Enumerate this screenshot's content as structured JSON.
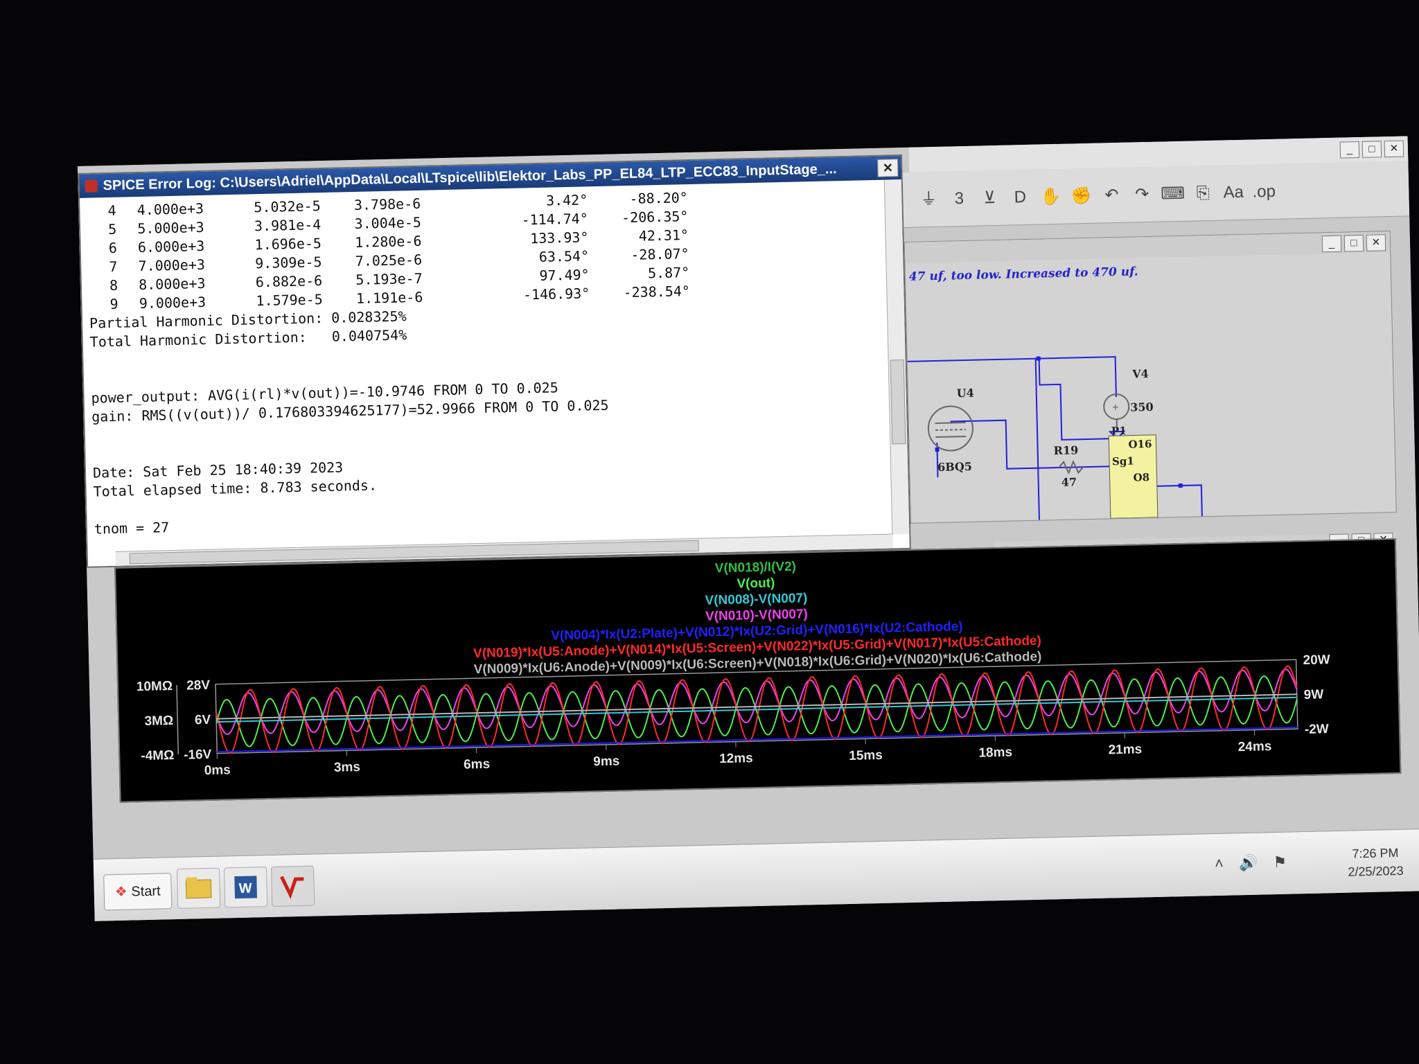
{
  "errlog": {
    "title": "SPICE Error Log: C:\\Users\\Adriel\\AppData\\Local\\LTspice\\lib\\Elektor_Labs_PP_EL84_LTP_ECC83_InputStage_...",
    "close": "✕",
    "harmonics": [
      {
        "n": "4",
        "freq": "4.000e+3",
        "fourier": "5.032e-5",
        "normalized": "3.798e-6",
        "phase": "3.42°",
        "norm_phase": "-88.20°"
      },
      {
        "n": "5",
        "freq": "5.000e+3",
        "fourier": "3.981e-4",
        "normalized": "3.004e-5",
        "phase": "-114.74°",
        "norm_phase": "-206.35°"
      },
      {
        "n": "6",
        "freq": "6.000e+3",
        "fourier": "1.696e-5",
        "normalized": "1.280e-6",
        "phase": "133.93°",
        "norm_phase": "42.31°"
      },
      {
        "n": "7",
        "freq": "7.000e+3",
        "fourier": "9.309e-5",
        "normalized": "7.025e-6",
        "phase": "63.54°",
        "norm_phase": "-28.07°"
      },
      {
        "n": "8",
        "freq": "8.000e+3",
        "fourier": "6.882e-6",
        "normalized": "5.193e-7",
        "phase": "97.49°",
        "norm_phase": "5.87°"
      },
      {
        "n": "9",
        "freq": "9.000e+3",
        "fourier": "1.579e-5",
        "normalized": "1.191e-6",
        "phase": "-146.93°",
        "norm_phase": "-238.54°"
      }
    ],
    "phd": "Partial Harmonic Distortion: 0.028325%",
    "thd": "Total Harmonic Distortion:   0.040754%",
    "power_output": "power_output: AVG(i(rl)*v(out))=-10.9746 FROM 0 TO 0.025",
    "gain": "gain: RMS((v(out))/ 0.176803394625177)=52.9966 FROM 0 TO 0.025",
    "date": "Date: Sat Feb 25 18:40:39 2023",
    "elapsed": "Total elapsed time: 8.783 seconds.",
    "tnom": "tnom = 27"
  },
  "schematic": {
    "comment": "47 uf, too low. Increased to 470 uf.",
    "labels": {
      "u4": "U4",
      "tube": "6BQ5",
      "v4": "V4",
      "v4val": "350",
      "r19": "R19",
      "r19val": "47",
      "p1": "P1",
      "o16": "O16",
      "sg1": "Sg1",
      "o8": "O8"
    }
  },
  "toolbar_icons": [
    "ground-icon",
    "inductor-icon",
    "diode-icon",
    "component-icon",
    "hand-drag-icon",
    "hand-move-icon",
    "undo-icon",
    "redo-icon",
    "text-icon",
    "spice-directive-icon",
    "font-icon",
    "op-icon"
  ],
  "toolbar_glyphs": [
    "⏚",
    "3",
    "⊻",
    "D",
    "✋",
    "✊",
    "↶",
    "↷",
    "⌨",
    "⎘",
    "Aa",
    ".op"
  ],
  "window_buttons": [
    "_",
    "□",
    "✕"
  ],
  "waveform": {
    "traces": [
      {
        "label": "V(N018)/I(V2)",
        "color": "#2fbf40"
      },
      {
        "label": "V(out)",
        "color": "#4df04d"
      },
      {
        "label": "V(N008)-V(N007)",
        "color": "#34c8d8"
      },
      {
        "label": "V(N010)-V(N007)",
        "color": "#f040f0"
      },
      {
        "label": "V(N004)*Ix(U2:Plate)+V(N012)*Ix(U2:Grid)+V(N016)*Ix(U2:Cathode)",
        "color": "#2020ff"
      },
      {
        "label": "V(N019)*Ix(U5:Anode)+V(N014)*Ix(U5:Screen)+V(N022)*Ix(U5:Grid)+V(N017)*Ix(U5:Cathode)",
        "color": "#ff2a2a"
      },
      {
        "label": "V(N009)*Ix(U6:Anode)+V(N009)*Ix(U6:Screen)+V(N018)*Ix(U6:Grid)+V(N020)*Ix(U6:Cathode)",
        "color": "#b8b8b8"
      }
    ]
  },
  "chart_data": {
    "type": "line",
    "x_unit": "ms",
    "xlim": [
      0,
      25
    ],
    "x_ticks": [
      "0ms",
      "3ms",
      "6ms",
      "9ms",
      "12ms",
      "15ms",
      "18ms",
      "21ms",
      "24ms"
    ],
    "y_axes": {
      "left_outer": {
        "ticks": [
          "10MΩ",
          "3MΩ",
          "-4MΩ"
        ],
        "range": [
          -4,
          10
        ],
        "unit": "MΩ"
      },
      "left_inner": {
        "ticks": [
          "28V",
          "6V",
          "-16V"
        ],
        "range": [
          -16,
          28
        ],
        "unit": "V"
      },
      "right": {
        "ticks": [
          "20W",
          "9W",
          "-2W"
        ],
        "range": [
          -2,
          20
        ],
        "unit": "W"
      }
    },
    "signal_frequency_khz": 1,
    "series": [
      {
        "name": "V(out)",
        "axis": "V",
        "shape": "sine",
        "amplitude": 15,
        "offset": 3
      },
      {
        "name": "V(N010)-V(N007)",
        "axis": "V",
        "shape": "sine",
        "amplitude": 13,
        "offset": 9
      },
      {
        "name": "V(N019)*Ix(U5:Anode)+V(N014)*Ix(U5:Screen)+V(N022)*Ix(U5:Grid)+V(N017)*Ix(U5:Cathode)",
        "axis": "W",
        "shape": "sine",
        "amplitude": 10,
        "offset": 8
      },
      {
        "name": "V(N008)-V(N007)",
        "axis": "V",
        "shape": "flat",
        "value": 4
      },
      {
        "name": "V(N004)*Ix(U2:Plate)+V(N012)*Ix(U2:Grid)+V(N016)*Ix(U2:Cathode)",
        "axis": "W",
        "shape": "flat",
        "value": -1.5
      },
      {
        "name": "V(N009)*Ix(U6:Anode)+V(N009)*Ix(U6:Screen)+V(N018)*Ix(U6:Grid)+V(N020)*Ix(U6:Cathode)",
        "axis": "W",
        "shape": "flat",
        "value": 9
      }
    ]
  },
  "taskbar": {
    "start": "Start",
    "time": "7:26 PM",
    "date": "2/25/2023",
    "tray_glyphs": "˄ 🔊 ⚑"
  }
}
